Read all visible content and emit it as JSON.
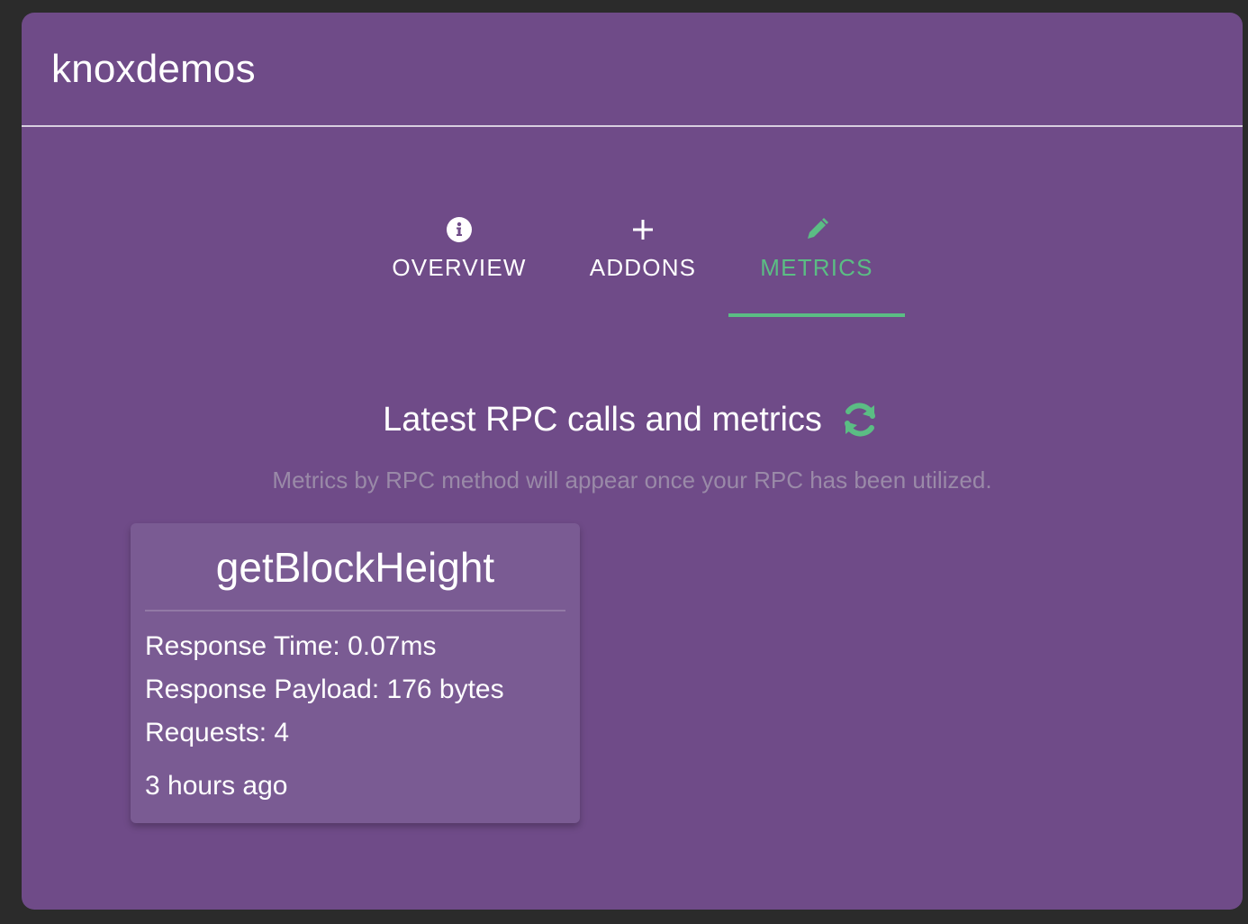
{
  "header": {
    "title": "knoxdemos"
  },
  "tabs": [
    {
      "label": "OVERVIEW",
      "icon": "info-circle-icon",
      "active": false
    },
    {
      "label": "ADDONS",
      "icon": "plus-icon",
      "active": false
    },
    {
      "label": "METRICS",
      "icon": "pencil-icon",
      "active": true
    }
  ],
  "metrics": {
    "title": "Latest RPC calls and metrics",
    "refresh_icon": "refresh-icon",
    "subtitle": "Metrics by RPC method will appear once your RPC has been utilized.",
    "cards": [
      {
        "method": "getBlockHeight",
        "response_time": "Response Time: 0.07ms",
        "response_payload": "Response Payload: 176 bytes",
        "requests": "Requests: 4",
        "age": "3 hours ago"
      }
    ]
  },
  "colors": {
    "background": "#2b2b2b",
    "panel": "#6f4b88",
    "card": "#7a5b93",
    "accent": "#5bbd84",
    "muted_text": "#9a8aa8"
  }
}
